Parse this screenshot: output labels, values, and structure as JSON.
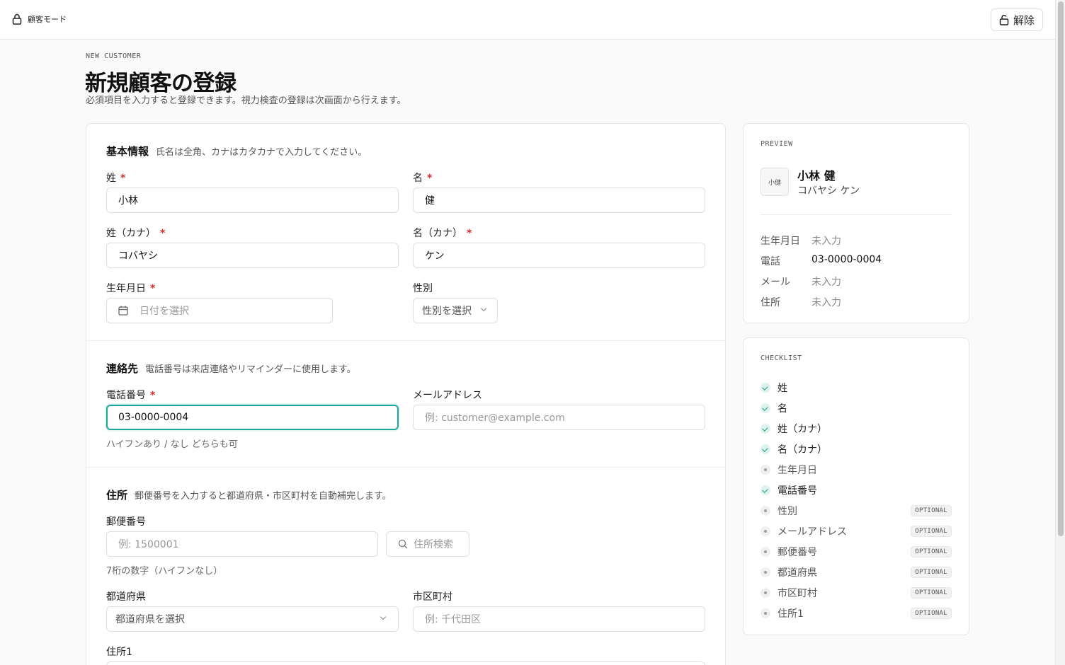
{
  "topbar": {
    "mode_label": "顧客モード",
    "unlock_label": "解除"
  },
  "header": {
    "eyebrow": "NEW CUSTOMER",
    "title": "新規顧客の登録",
    "subtitle": "必須項目を入力すると登録できます。視力検査の登録は次画面から行えます。"
  },
  "basic": {
    "title": "基本情報",
    "desc": "氏名は全角、カナはカタカナで入力してください。",
    "last_name_label": "姓",
    "last_name_value": "小林",
    "first_name_label": "名",
    "first_name_value": "健",
    "last_kana_label": "姓（カナ）",
    "last_kana_value": "コバヤシ",
    "first_kana_label": "名（カナ）",
    "first_kana_value": "ケン",
    "birth_label": "生年月日",
    "birth_placeholder": "日付を選択",
    "gender_label": "性別",
    "gender_placeholder": "性別を選択"
  },
  "contact": {
    "title": "連絡先",
    "desc": "電話番号は来店連絡やリマインダーに使用します。",
    "phone_label": "電話番号",
    "phone_value": "03-0000-0004",
    "phone_hint": "ハイフンあり / なし どちらも可",
    "email_label": "メールアドレス",
    "email_placeholder": "例: customer@example.com"
  },
  "address": {
    "title": "住所",
    "desc": "郵便番号を入力すると都道府県・市区町村を自動補完します。",
    "postal_label": "郵便番号",
    "postal_placeholder": "例: 1500001",
    "search_label": "住所検索",
    "postal_hint": "7桁の数字（ハイフンなし）",
    "pref_label": "都道府県",
    "pref_placeholder": "都道府県を選択",
    "city_label": "市区町村",
    "city_placeholder": "例: 千代田区",
    "addr1_label": "住所1"
  },
  "preview": {
    "eyebrow": "PREVIEW",
    "avatar": "小健",
    "name": "小林 健",
    "kana": "コバヤシ ケン",
    "rows": [
      {
        "key": "生年月日",
        "value": "未入力"
      },
      {
        "key": "電話",
        "value": "03-0000-0004"
      },
      {
        "key": "メール",
        "value": "未入力"
      },
      {
        "key": "住所",
        "value": "未入力"
      }
    ]
  },
  "checklist": {
    "eyebrow": "CHECKLIST",
    "items": [
      {
        "label": "姓",
        "done": true
      },
      {
        "label": "名",
        "done": true
      },
      {
        "label": "姓（カナ）",
        "done": true
      },
      {
        "label": "名（カナ）",
        "done": true
      },
      {
        "label": "生年月日",
        "done": false
      },
      {
        "label": "電話番号",
        "done": true
      },
      {
        "label": "性別",
        "done": false,
        "badge": "OPTIONAL"
      },
      {
        "label": "メールアドレス",
        "done": false,
        "badge": "OPTIONAL"
      },
      {
        "label": "郵便番号",
        "done": false,
        "badge": "OPTIONAL"
      },
      {
        "label": "都道府県",
        "done": false,
        "badge": "OPTIONAL"
      },
      {
        "label": "市区町村",
        "done": false,
        "badge": "OPTIONAL"
      },
      {
        "label": "住所1",
        "done": false,
        "badge": "OPTIONAL"
      }
    ]
  },
  "colors": {
    "accent": "#1aa89b",
    "required": "#d32f2f",
    "done": "#1a9c7e"
  },
  "icons": {
    "mode": "lock-icon",
    "unlock": "unlock-icon",
    "calendar": "calendar-icon",
    "search": "search-icon",
    "chevron": "chevron-down-icon"
  }
}
